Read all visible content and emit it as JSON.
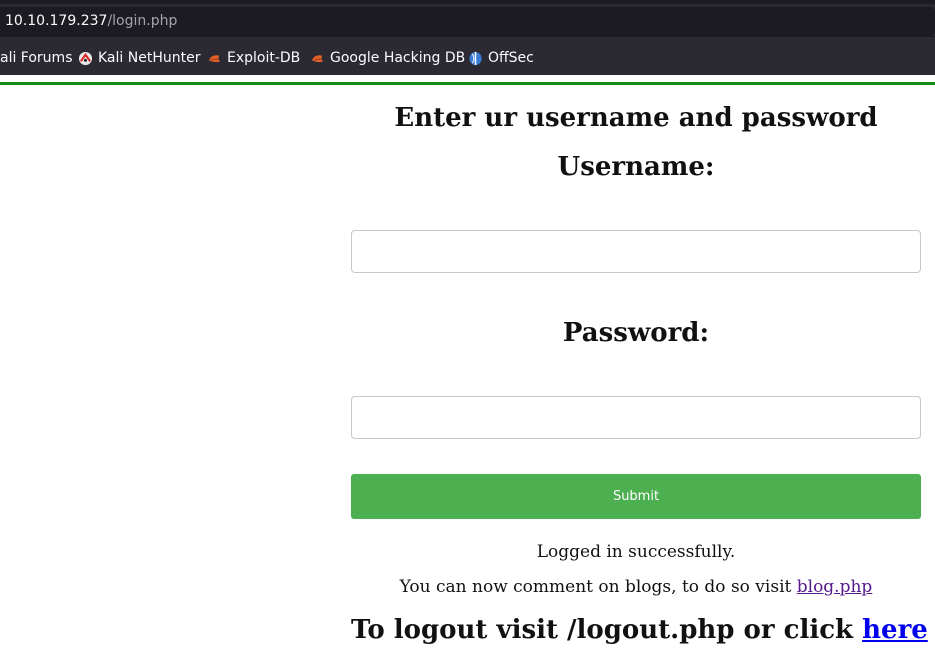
{
  "browser": {
    "url_host": "10.10.179.237",
    "url_path": "/login.php",
    "bookmarks": [
      {
        "label": "ali Forums",
        "icon": "kali-dragon-icon"
      },
      {
        "label": "Kali NetHunter",
        "icon": "nethunter-icon"
      },
      {
        "label": "Exploit-DB",
        "icon": "exploitdb-icon"
      },
      {
        "label": "Google Hacking DB",
        "icon": "ghdb-icon"
      },
      {
        "label": "OffSec",
        "icon": "offsec-icon"
      }
    ]
  },
  "page": {
    "heading": "Enter ur username and password",
    "username_label": "Username:",
    "username_value": "",
    "password_label": "Password:",
    "password_value": "",
    "submit_label": "Submit",
    "status_message": "Logged in successfully.",
    "blog_message": "You can now comment on blogs, to do so visit ",
    "blog_link": "blog.php",
    "logout_message": "To logout visit /logout.php or click ",
    "logout_link": "here"
  },
  "colors": {
    "accent_rule": "#178a17",
    "submit_bg": "#4caf50",
    "visited_link": "#551a8b",
    "link": "#0000ee"
  }
}
